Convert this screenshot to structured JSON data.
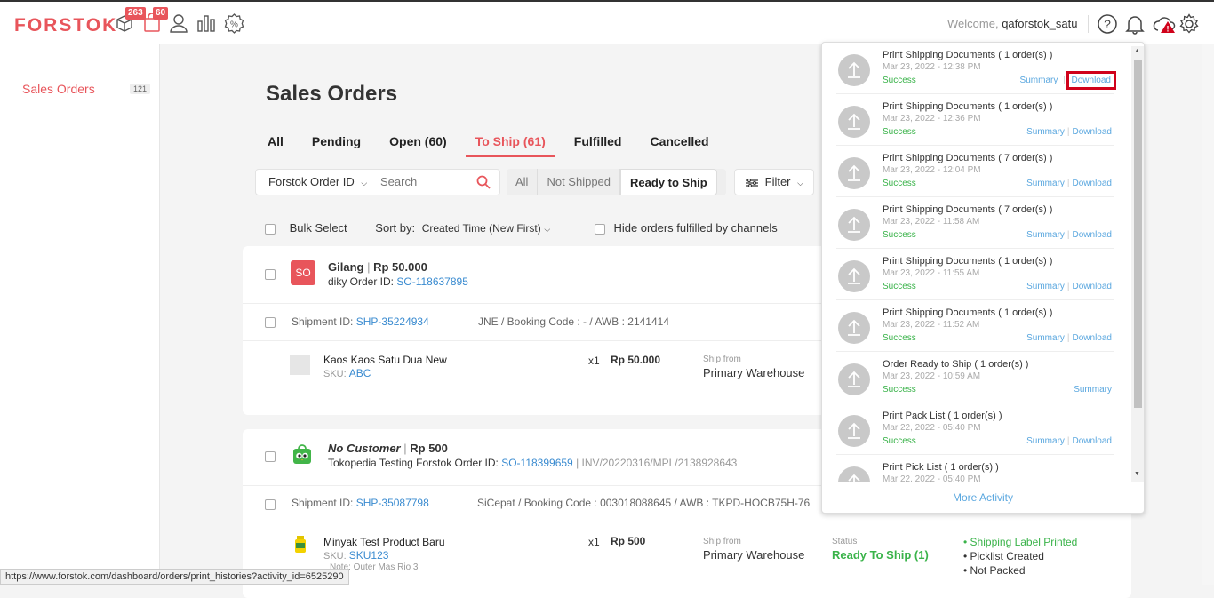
{
  "header": {
    "logo": "FORSTOK",
    "badge_products": "263",
    "badge_orders": "60",
    "welcome_prefix": "Welcome,",
    "username": "qaforstok_satu"
  },
  "sidebar": {
    "items": [
      {
        "label": "Sales Orders",
        "count": "121"
      }
    ]
  },
  "main": {
    "title": "Sales Orders",
    "tabs": [
      "All",
      "Pending",
      "Open (60)",
      "To Ship (61)",
      "Fulfilled",
      "Cancelled"
    ],
    "search_field": "Forstok Order ID",
    "search_placeholder": "Search",
    "ship_filters": [
      "All",
      "Not Shipped",
      "Ready to Ship"
    ],
    "filter_label": "Filter",
    "bulk_select": "Bulk Select",
    "sort_label": "Sort by:",
    "sort_value": "Created Time (New First)",
    "hide_label": "Hide orders fulfilled by channels"
  },
  "orders": [
    {
      "avatar": "SO",
      "customer": "Gilang",
      "total": "Rp 50.000",
      "channel_prefix": "diky Order ID:",
      "order_id": "SO-118637895",
      "invoice": "",
      "shipment_label": "Shipment ID:",
      "shipment_id": "SHP-35224934",
      "courier": "JNE / Booking Code : - / AWB : 2141414",
      "item_name": "Kaos Kaos Satu Dua New",
      "sku_label": "SKU:",
      "sku": "ABC",
      "qty": "x1",
      "price": "Rp 50.000",
      "ship_from_label": "Ship from",
      "ship_from": "Primary Warehouse"
    },
    {
      "customer": "No Customer",
      "total": "Rp 500",
      "channel_prefix": "Tokopedia Testing Forstok Order ID:",
      "order_id": "SO-118399659",
      "invoice": "INV/20220316/MPL/2138928643",
      "shipment_label": "Shipment ID:",
      "shipment_id": "SHP-35087798",
      "courier": "SiCepat / Booking Code : 003018088645 / AWB : TKPD-HOCB75H-76",
      "item_name": "Minyak Test Product Baru",
      "sku_label": "SKU:",
      "sku": "SKU123",
      "note": "Note: Outer Mas Rio 3",
      "qty": "x1",
      "price": "Rp 500",
      "ship_from_label": "Ship from",
      "ship_from": "Primary Warehouse",
      "status_label": "Status",
      "status": "Ready To Ship (1)",
      "checklist": [
        "Shipping Label Printed",
        "Picklist Created",
        "Not Packed"
      ]
    }
  ],
  "activity": {
    "items": [
      {
        "title": "Print Shipping Documents ( 1 order(s) )",
        "date": "Mar 23, 2022 - 12:38 PM",
        "status": "Success",
        "summary": "Summary",
        "download": "Download"
      },
      {
        "title": "Print Shipping Documents ( 1 order(s) )",
        "date": "Mar 23, 2022 - 12:36 PM",
        "status": "Success",
        "summary": "Summary",
        "download": "Download"
      },
      {
        "title": "Print Shipping Documents ( 7 order(s) )",
        "date": "Mar 23, 2022 - 12:04 PM",
        "status": "Success",
        "summary": "Summary",
        "download": "Download"
      },
      {
        "title": "Print Shipping Documents ( 7 order(s) )",
        "date": "Mar 23, 2022 - 11:58 AM",
        "status": "Success",
        "summary": "Summary",
        "download": "Download"
      },
      {
        "title": "Print Shipping Documents ( 1 order(s) )",
        "date": "Mar 23, 2022 - 11:55 AM",
        "status": "Success",
        "summary": "Summary",
        "download": "Download"
      },
      {
        "title": "Print Shipping Documents ( 1 order(s) )",
        "date": "Mar 23, 2022 - 11:52 AM",
        "status": "Success",
        "summary": "Summary",
        "download": "Download"
      },
      {
        "title": "Order Ready to Ship ( 1 order(s) )",
        "date": "Mar 23, 2022 - 10:59 AM",
        "status": "Success",
        "summary": "Summary",
        "download": ""
      },
      {
        "title": "Print Pack List ( 1 order(s) )",
        "date": "Mar 22, 2022 - 05:40 PM",
        "status": "Success",
        "summary": "Summary",
        "download": "Download"
      },
      {
        "title": "Print Pick List ( 1 order(s) )",
        "date": "Mar 22, 2022 - 05:40 PM",
        "status": "",
        "summary": "",
        "download": ""
      }
    ],
    "more": "More Activity"
  },
  "statusbar": {
    "url": "https://www.forstok.com/dashboard/orders/print_histories?activity_id=6525290"
  },
  "colors": {
    "brand": "#e8555b",
    "link": "#3a8bd0",
    "success": "#3ab34a",
    "highlight": "#d0021b"
  }
}
